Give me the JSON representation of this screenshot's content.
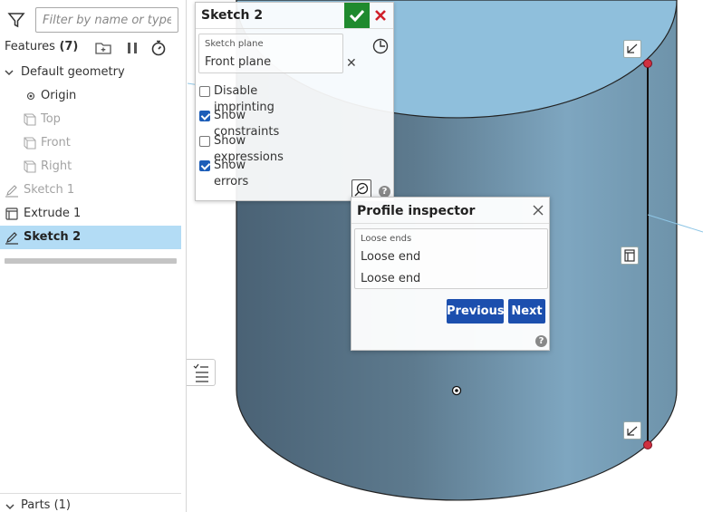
{
  "filter": {
    "placeholder": "Filter by name or type"
  },
  "features": {
    "title": "Features",
    "count": "(7)"
  },
  "tree": {
    "default_geometry": "Default geometry",
    "origin": "Origin",
    "top": "Top",
    "front": "Front",
    "right": "Right",
    "sketch1": "Sketch 1",
    "extrude1": "Extrude 1",
    "sketch2": "Sketch 2"
  },
  "parts": {
    "label": "Parts (1)"
  },
  "sketch_dialog": {
    "title": "Sketch 2",
    "plane_caption": "Sketch plane",
    "plane_value": "Front plane",
    "clear_glyph": "✕",
    "options": [
      {
        "label": "Disable imprinting",
        "checked": false
      },
      {
        "label": "Show constraints",
        "checked": true
      },
      {
        "label": "Show expressions",
        "checked": false
      },
      {
        "label": "Show errors",
        "checked": true
      }
    ],
    "help_glyph": "?"
  },
  "profile_inspector": {
    "title": "Profile inspector",
    "caption": "Loose ends",
    "items": [
      "Loose end",
      "Loose end"
    ],
    "previous_label": "Previous",
    "next_label": "Next",
    "help_glyph": "?"
  },
  "colors": {
    "accent_blue": "#1c4fae",
    "ok_green": "#1f8a2e",
    "cancel_red": "#d0202a",
    "selection": "#b3dcf5",
    "cylinder_top": "#8fbfdc",
    "cylinder_side_dark": "#4b6477",
    "cylinder_side_light": "#7fa8c2"
  }
}
